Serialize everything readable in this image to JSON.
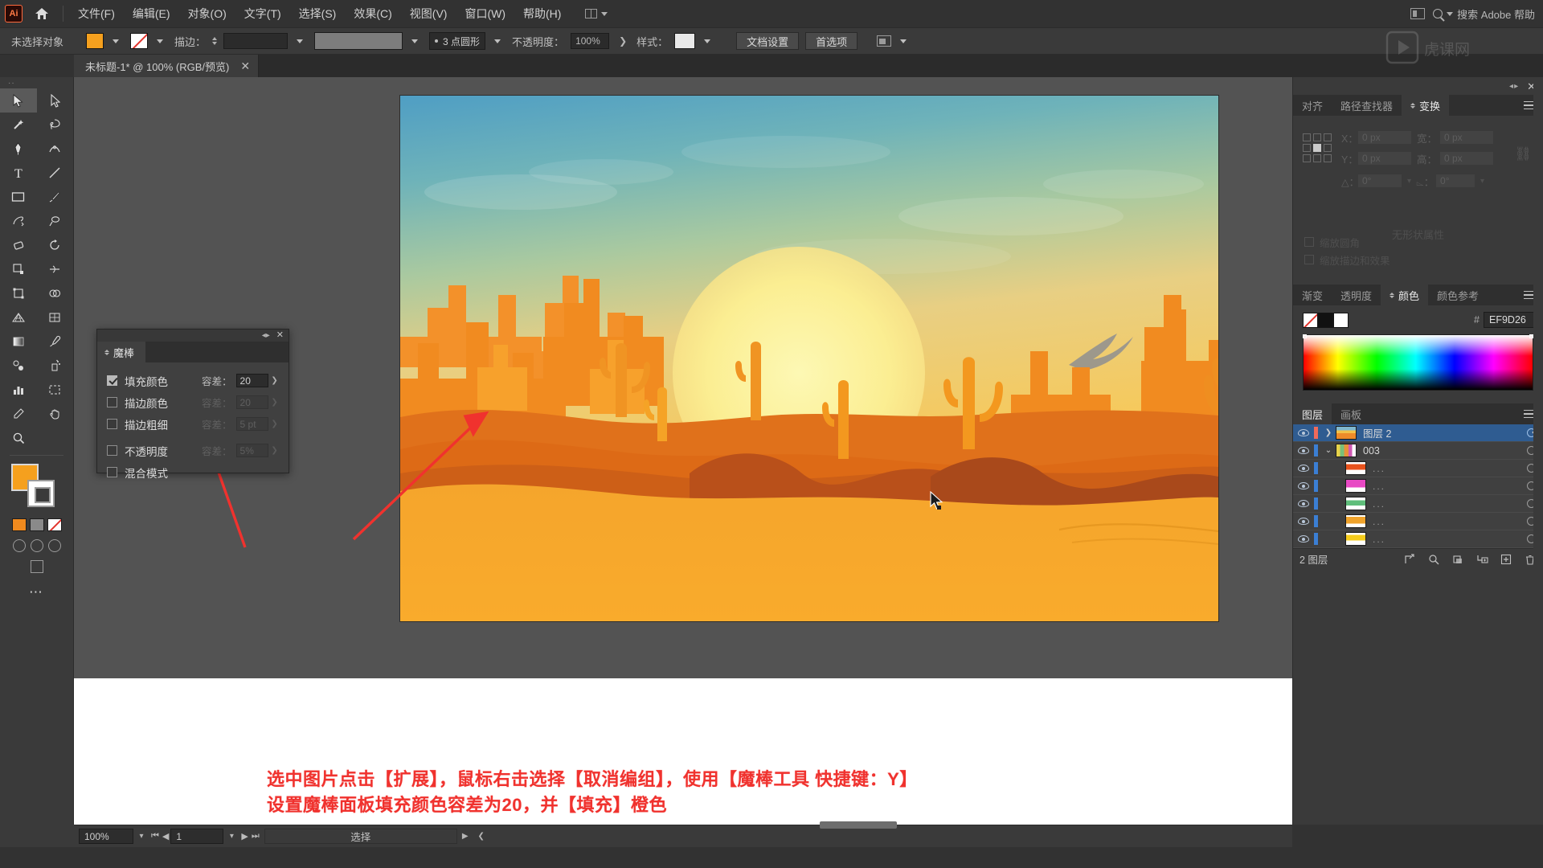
{
  "app": {
    "logo": "Ai",
    "home_icon": "home-icon"
  },
  "menubar": {
    "items": [
      "文件(F)",
      "编辑(E)",
      "对象(O)",
      "文字(T)",
      "选择(S)",
      "效果(C)",
      "视图(V)",
      "窗口(W)",
      "帮助(H)"
    ],
    "workspace_label": "",
    "search_placeholder": "搜索 Adobe 帮助"
  },
  "controlbar": {
    "selection_status": "未选择对象",
    "fill_color": "#F5A01E",
    "stroke_color": "none",
    "stroke_label": "描边：",
    "stroke_weight": "",
    "brush_value": "",
    "profile_label": "3 点圆形",
    "opacity_label": "不透明度：",
    "opacity_value": "100%",
    "style_label": "样式：",
    "doc_setup_button": "文档设置",
    "preferences_button": "首选项"
  },
  "document_tab": {
    "title": "未标题-1* @ 100% (RGB/预览)",
    "close": "✕"
  },
  "toolbar": {
    "tools": [
      "selection-tool",
      "direct-selection-tool",
      "magic-wand-tool",
      "lasso-tool",
      "pen-tool",
      "curvature-tool",
      "type-tool",
      "line-segment-tool",
      "rectangle-tool",
      "paintbrush-tool",
      "shaper-tool",
      "blob-brush-tool",
      "eraser-tool",
      "rotate-tool",
      "scale-tool",
      "width-tool",
      "free-transform-tool",
      "shape-builder-tool",
      "perspective-grid-tool",
      "mesh-tool",
      "gradient-tool",
      "eyedropper-tool",
      "blend-tool",
      "symbol-sprayer-tool",
      "column-graph-tool",
      "artboard-tool",
      "slice-tool",
      "hand-tool",
      "zoom-tool"
    ],
    "fill_swatch": "#F5A01E",
    "stroke_swatch": "#FFFFFF",
    "more_tools": "⋯"
  },
  "magic_wand_panel": {
    "title": "魔棒",
    "close": "✕",
    "rows": [
      {
        "label": "填充颜色",
        "checked": true,
        "tol_label": "容差：",
        "tol_value": "20",
        "enabled": true
      },
      {
        "label": "描边颜色",
        "checked": false,
        "tol_label": "容差：",
        "tol_value": "20",
        "enabled": false
      },
      {
        "label": "描边粗细",
        "checked": false,
        "tol_label": "容差：",
        "tol_value": "5 pt",
        "enabled": false
      },
      {
        "label": "不透明度",
        "checked": false,
        "tol_label": "容差：",
        "tol_value": "5%",
        "enabled": false
      },
      {
        "label": "混合模式",
        "checked": false,
        "tol_label": "",
        "tol_value": "",
        "enabled": false
      }
    ]
  },
  "transform_panel": {
    "tabs": [
      "对齐",
      "路径查找器",
      "变换"
    ],
    "active_tab": "变换",
    "fields": {
      "x_label": "X：",
      "x_value": "0 px",
      "y_label": "Y：",
      "y_value": "0 px",
      "w_label": "宽：",
      "w_value": "0 px",
      "h_label": "高：",
      "h_value": "0 px",
      "angle_label": "△：",
      "angle_value": "0°",
      "shear_label": "⌳：",
      "shear_value": "0°"
    },
    "no_props_text": "无形状属性",
    "checkboxes": [
      "缩放圆角",
      "缩放描边和效果"
    ]
  },
  "color_panel": {
    "tabs": [
      "渐变",
      "透明度",
      "颜色",
      "颜色参考"
    ],
    "active_tab": "颜色",
    "hash": "#",
    "hex_value": "EF9D26",
    "swatches": [
      "none",
      "#111111",
      "#FFFFFF"
    ]
  },
  "layers_panel": {
    "tabs": [
      "图层",
      "画板"
    ],
    "active_tab": "图层",
    "rows": [
      {
        "name": "图层 2",
        "selected": true,
        "indent": 0,
        "expandable": true,
        "expanded": false,
        "color": "#f06a5a",
        "thumb": "sunset",
        "eye": true
      },
      {
        "name": "003",
        "selected": false,
        "indent": 0,
        "expandable": true,
        "expanded": true,
        "color": "#3b7fd4",
        "thumb": "group",
        "eye": true
      },
      {
        "name": "...",
        "selected": false,
        "indent": 1,
        "expandable": false,
        "expanded": false,
        "color": "#3b7fd4",
        "thumb": "orange",
        "eye": true
      },
      {
        "name": "...",
        "selected": false,
        "indent": 1,
        "expandable": false,
        "expanded": false,
        "color": "#3b7fd4",
        "thumb": "magenta",
        "eye": true
      },
      {
        "name": "...",
        "selected": false,
        "indent": 1,
        "expandable": false,
        "expanded": false,
        "color": "#3b7fd4",
        "thumb": "green",
        "eye": true
      },
      {
        "name": "...",
        "selected": false,
        "indent": 1,
        "expandable": false,
        "expanded": false,
        "color": "#3b7fd4",
        "thumb": "amber",
        "eye": true
      },
      {
        "name": "...",
        "selected": false,
        "indent": 1,
        "expandable": false,
        "expanded": false,
        "color": "#3b7fd4",
        "thumb": "yellow",
        "eye": true
      }
    ],
    "footer_count": "2 图层",
    "footer_icons": [
      "locate-object-icon",
      "search-icon",
      "make-clipping-mask-icon",
      "create-sublayer-icon",
      "create-new-layer-icon",
      "delete-layer-icon"
    ]
  },
  "statusbar": {
    "zoom_value": "100%",
    "page_value": "1",
    "status_text": "选择"
  },
  "annotation": {
    "line1": "选中图片点击【扩展】，鼠标右击选择【取消编组】，使用【魔棒工具 快捷键：Y】",
    "line2": "设置魔棒面板填充颜色容差为20，并【填充】橙色",
    "color": "#F0322E"
  },
  "artwork": {
    "description": "desert-sunset-illustration",
    "sky_top": "#5aa8cf",
    "sky_mid": "#9cc9a8",
    "sky_low": "#f2d479",
    "sun": "#fdf6a8",
    "sand_front": "#f5a32a",
    "rock_dark": "#d4581b",
    "rock_mid": "#f07d1e"
  }
}
